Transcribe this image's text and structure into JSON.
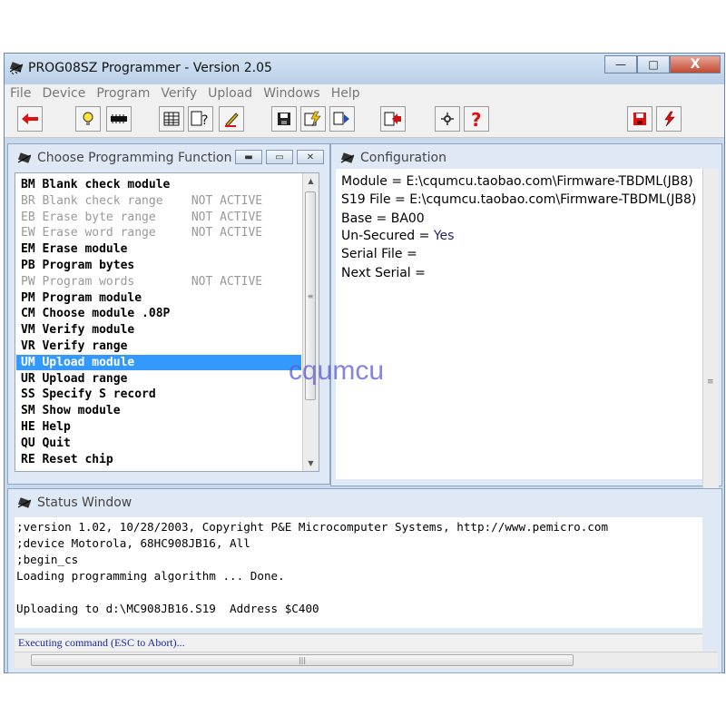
{
  "window": {
    "title": "PROG08SZ Programmer - Version 2.05"
  },
  "title_buttons": {
    "minimize": "—",
    "maximize": "□",
    "close": "X"
  },
  "menu": [
    "File",
    "Device",
    "Program",
    "Verify",
    "Upload",
    "Windows",
    "Help"
  ],
  "toolbar_icons": [
    "back-arrow-icon",
    "bulb-icon",
    "chip-icon",
    "table-icon",
    "page-question-icon",
    "pencil-icon",
    "save-icon",
    "flash-icon",
    "reload-icon",
    "page-arrow-icon",
    "wrench-icon",
    "question-icon",
    "save-red-icon",
    "flash-red-icon"
  ],
  "function_panel": {
    "title": "Choose Programming Function",
    "items": [
      {
        "text": "BM Blank check module",
        "state": "active"
      },
      {
        "text": "BR Blank check range    NOT ACTIVE",
        "state": "inactive"
      },
      {
        "text": "EB Erase byte range     NOT ACTIVE",
        "state": "inactive"
      },
      {
        "text": "EW Erase word range     NOT ACTIVE",
        "state": "inactive"
      },
      {
        "text": "EM Erase module",
        "state": "active"
      },
      {
        "text": "PB Program bytes",
        "state": "active"
      },
      {
        "text": "PW Program words        NOT ACTIVE",
        "state": "inactive"
      },
      {
        "text": "PM Program module",
        "state": "active"
      },
      {
        "text": "CM Choose module .08P",
        "state": "active"
      },
      {
        "text": "VM Verify module",
        "state": "active"
      },
      {
        "text": "VR Verify range",
        "state": "active"
      },
      {
        "text": "UM Upload module",
        "state": "selected"
      },
      {
        "text": "UR Upload range",
        "state": "active"
      },
      {
        "text": "SS Specify S record",
        "state": "active"
      },
      {
        "text": "SM Show module",
        "state": "active"
      },
      {
        "text": "HE Help",
        "state": "active"
      },
      {
        "text": "QU Quit",
        "state": "active"
      },
      {
        "text": "RE Reset chip",
        "state": "active"
      }
    ]
  },
  "config_panel": {
    "title": "Configuration",
    "module": "Module = E:\\cqumcu.taobao.com\\Firmware-TBDML(JB8)",
    "s19_file": "S19 File = E:\\cqumcu.taobao.com\\Firmware-TBDML(JB8)",
    "base": "Base = BA00",
    "unsecured_label": "Un-Secured = ",
    "unsecured_value": "Yes",
    "serial_file": "Serial File =",
    "next_serial": "Next Serial ="
  },
  "status_panel": {
    "title": "Status Window",
    "lines": [
      ";version 1.02, 10/28/2003, Copyright P&E Microcomputer Systems, http://www.pemicro.com",
      ";device Motorola, 68HC908JB16, All",
      ";begin_cs",
      "Loading programming algorithm ... Done.",
      "",
      "Uploading to d:\\MC908JB16.S19  Address $C400"
    ],
    "statusbar": "Executing command (ESC to Abort)..."
  },
  "watermark": "cqumcu",
  "colors": {
    "selection": "#3399ff",
    "inactive_text": "#999999",
    "accent": "#1b2a9b"
  }
}
